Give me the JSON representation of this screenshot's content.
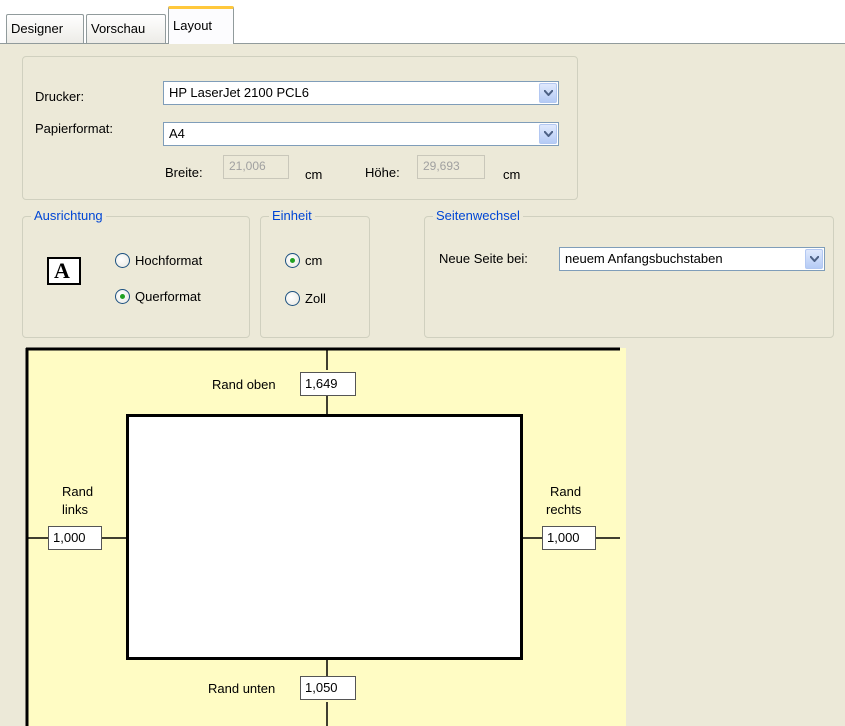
{
  "tabs": [
    {
      "label": "Designer"
    },
    {
      "label": "Vorschau"
    },
    {
      "label": "Layout"
    }
  ],
  "printer_group": {
    "printer_label": "Drucker:",
    "printer_value": "HP LaserJet 2100 PCL6",
    "paper_label": "Papierformat:",
    "paper_value": "A4",
    "width_label": "Breite:",
    "width_value": "21,006",
    "width_unit": "cm",
    "height_label": "Höhe:",
    "height_value": "29,693",
    "height_unit": "cm"
  },
  "orientation": {
    "title": "Ausrichtung",
    "icon_letter": "A",
    "options": [
      {
        "label": "Hochformat",
        "selected": false
      },
      {
        "label": "Querformat",
        "selected": true
      }
    ]
  },
  "unit": {
    "title": "Einheit",
    "options": [
      {
        "label": "cm",
        "selected": true
      },
      {
        "label": "Zoll",
        "selected": false
      }
    ]
  },
  "page_break": {
    "title": "Seitenwechsel",
    "label": "Neue Seite bei:",
    "value": "neuem Anfangsbuchstaben"
  },
  "margins": {
    "top_label": "Rand oben",
    "top_value": "1,649",
    "left_label_1": "Rand",
    "left_label_2": "links",
    "left_value": "1,000",
    "right_label_1": "Rand",
    "right_label_2": "rechts",
    "right_value": "1,000",
    "bottom_label": "Rand unten",
    "bottom_value": "1,050"
  },
  "colors": {
    "group_title": "#0046d5",
    "preview_background": "#fffcc4",
    "radio_selected_dot": "#21a121",
    "active_tab_accent": "#ffc83c"
  }
}
